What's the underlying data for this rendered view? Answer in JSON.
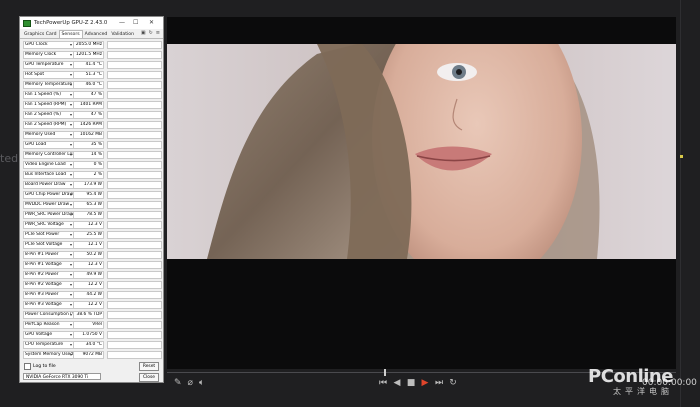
{
  "gpuz": {
    "title": "TechPowerUp GPU-Z 2.43.0",
    "tabs": [
      "Graphics Card",
      "Sensors",
      "Advanced",
      "Validation"
    ],
    "active_tab": "Sensors",
    "window_buttons": {
      "minimize": "—",
      "restore": "☐",
      "close": "✕"
    },
    "sensors": [
      {
        "label": "GPU Clock",
        "value": "2055.0 MHz",
        "level": 0.9
      },
      {
        "label": "Memory Clock",
        "value": "1201.5 MHz",
        "level": 0.9
      },
      {
        "label": "GPU Temperature",
        "value": "41.4 °C",
        "level": 0.55
      },
      {
        "label": "Hot Spot",
        "value": "51.3 °C",
        "level": 0.6
      },
      {
        "label": "Memory Temperature",
        "value": "46.0 °C",
        "level": 0.55
      },
      {
        "label": "Fan 1 Speed (%)",
        "value": "47 %",
        "level": 0.5
      },
      {
        "label": "Fan 1 Speed (RPM)",
        "value": "1401 RPM",
        "level": 0.5
      },
      {
        "label": "Fan 2 Speed (%)",
        "value": "47 %",
        "level": 0.5
      },
      {
        "label": "Fan 2 Speed (RPM)",
        "value": "1426 RPM",
        "level": 0.5
      },
      {
        "label": "Memory Used",
        "value": "10162 MB",
        "level": 0.7
      },
      {
        "label": "GPU Load",
        "value": "35 %",
        "level": 0.35
      },
      {
        "label": "Memory Controller Load",
        "value": "14 %",
        "level": 0.15
      },
      {
        "label": "Video Engine Load",
        "value": "0 %",
        "level": 0.0
      },
      {
        "label": "Bus Interface Load",
        "value": "2 %",
        "level": 0.05
      },
      {
        "label": "Board Power Draw",
        "value": "173.9 W",
        "level": 0.4
      },
      {
        "label": "GPU Chip Power Draw",
        "value": "95.4 W",
        "level": 0.35
      },
      {
        "label": "MVDDC Power Draw",
        "value": "65.3 W",
        "level": 0.4
      },
      {
        "label": "PWR_SRC Power Draw",
        "value": "78.5 W",
        "level": 0.4
      },
      {
        "label": "PWR_SRC Voltage",
        "value": "12.3 V",
        "level": 0.85
      },
      {
        "label": "PCIe Slot Power",
        "value": "25.5 W",
        "level": 0.3
      },
      {
        "label": "PCIe Slot Voltage",
        "value": "12.1 V",
        "level": 0.85
      },
      {
        "label": "8-Pin #1 Power",
        "value": "50.2 W",
        "level": 0.4
      },
      {
        "label": "8-Pin #1 Voltage",
        "value": "12.3 V",
        "level": 0.85
      },
      {
        "label": "8-Pin #2 Power",
        "value": "49.9 W",
        "level": 0.4
      },
      {
        "label": "8-Pin #2 Voltage",
        "value": "12.2 V",
        "level": 0.85
      },
      {
        "label": "8-Pin #3 Power",
        "value": "44.2 W",
        "level": 0.35
      },
      {
        "label": "8-Pin #3 Voltage",
        "value": "12.2 V",
        "level": 0.85
      },
      {
        "label": "Power Consumption (%)",
        "value": "38.6 % TDP",
        "level": 0.4
      },
      {
        "label": "PerfCap Reason",
        "value": "VRel",
        "level": 1.0,
        "perf": true
      },
      {
        "label": "GPU Voltage",
        "value": "1.0750 V",
        "level": 0.8
      },
      {
        "label": "CPU Temperature",
        "value": "34.0 °C",
        "level": 0.3
      },
      {
        "label": "System Memory Used",
        "value": "9072 MB",
        "level": 0.55
      }
    ],
    "log_label": "Log to file",
    "reset_label": "Reset",
    "gpu_name": "NVIDIA GeForce RTX 3090 Ti",
    "close_label": "Close"
  },
  "editor": {
    "edge_text": "ted",
    "timecode": "00:00:00:00"
  },
  "watermark": {
    "brand": "PConline",
    "sub": "太平洋电脑"
  },
  "colors": {
    "graph": "#e01414",
    "perfcap": "#7a9ac8",
    "accent_play": "#e0452b"
  }
}
